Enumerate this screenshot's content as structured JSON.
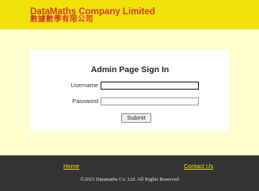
{
  "header": {
    "company_name_en": "DataMaths Company Limited",
    "company_name_zh": "數據數學有限公司"
  },
  "login": {
    "title": "Admin Page Sign In",
    "username_label": "Username",
    "username_value": "",
    "password_label": "Password",
    "password_value": "",
    "submit_label": "Submit"
  },
  "footer": {
    "home_link": "Home",
    "contact_link": "Contact Us",
    "copyright": "©2023 Datamaths Co. Ltd.    All Rights Reserved"
  },
  "colors": {
    "header_bg": "#f1e10a",
    "brand_text": "#d63a2e",
    "content_bg": "#fefecf",
    "footer_bg": "#333333",
    "footer_link": "#f1e10a"
  }
}
